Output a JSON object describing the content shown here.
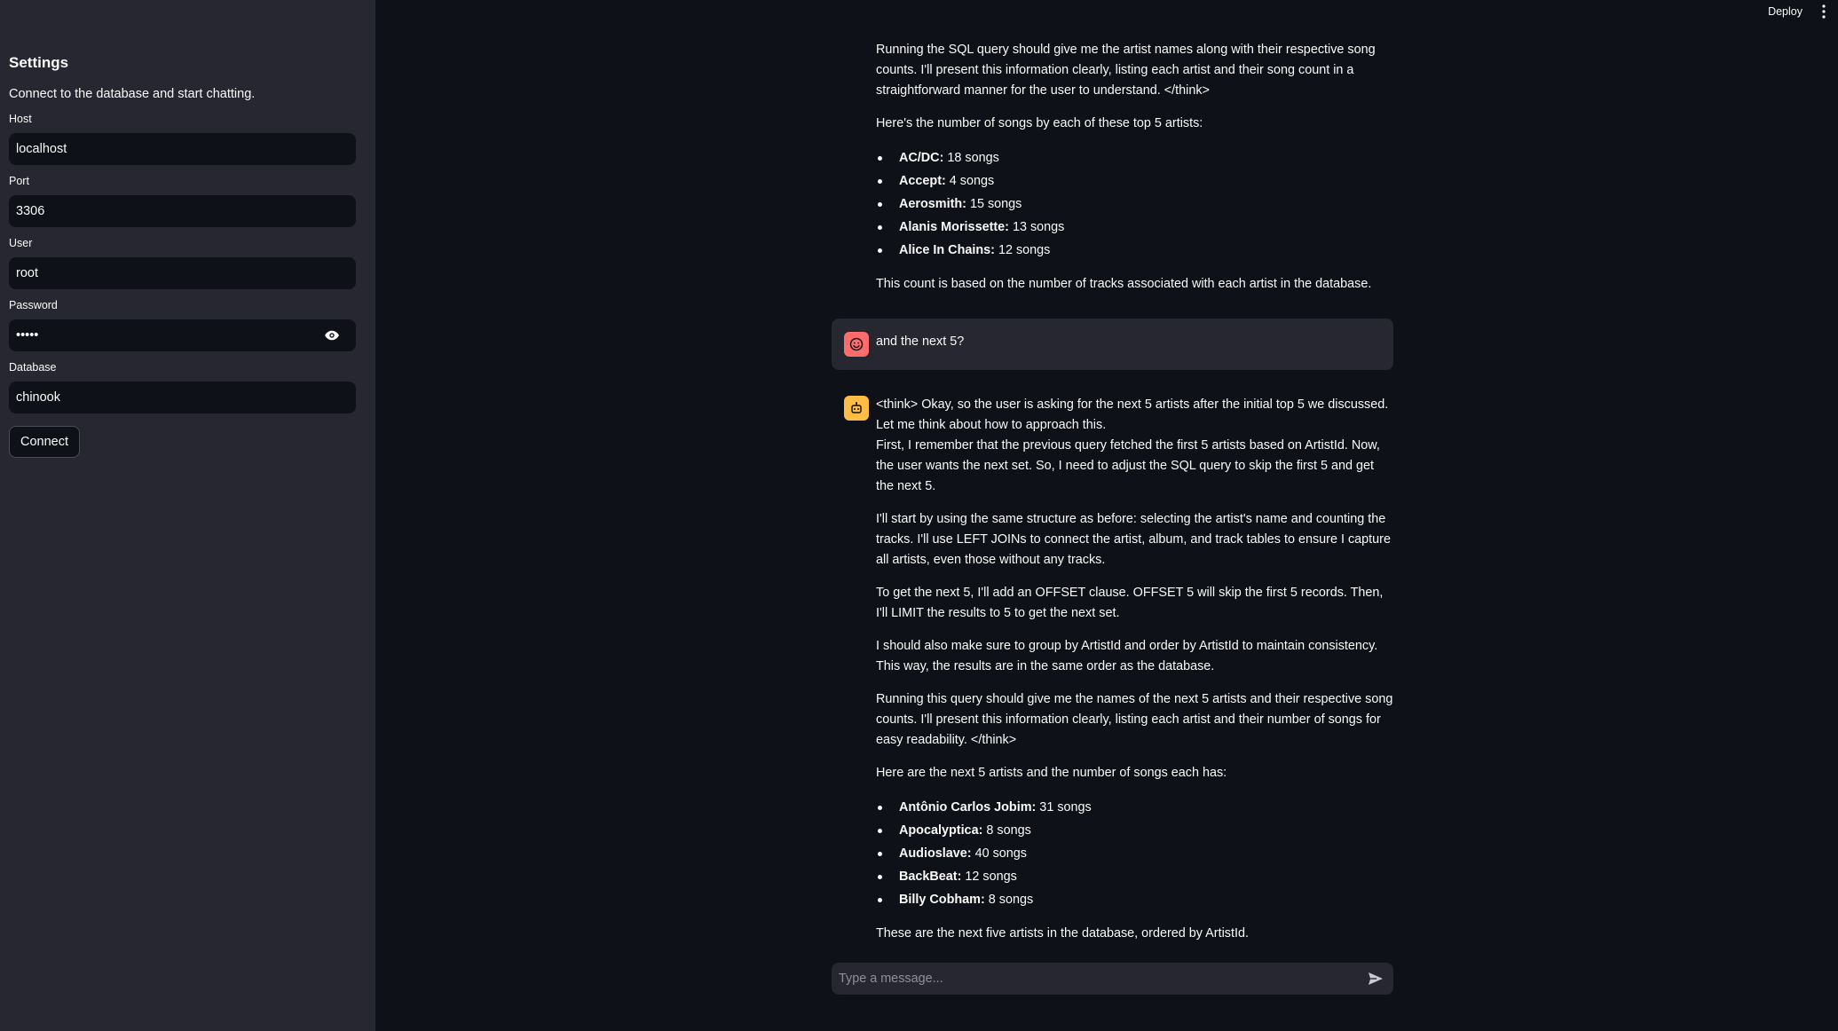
{
  "header": {
    "deploy_label": "Deploy",
    "menu_icon": "kebab-menu-icon"
  },
  "sidebar": {
    "title": "Settings",
    "caption": "Connect to the database and start chatting.",
    "fields": {
      "host": {
        "label": "Host",
        "value": "localhost"
      },
      "port": {
        "label": "Port",
        "value": "3306"
      },
      "user": {
        "label": "User",
        "value": "root"
      },
      "password": {
        "label": "Password",
        "value": "•••••"
      },
      "database": {
        "label": "Database",
        "value": "chinook"
      }
    },
    "connect_label": "Connect"
  },
  "chat": {
    "assistant_prev": {
      "p1": "Running the SQL query should give me the artist names along with their respective song counts. I'll present this information clearly, listing each artist and their song count in a straightforward manner for the user to understand. </think>",
      "p2": "Here's the number of songs by each of these top 5 artists:",
      "items": [
        {
          "name": "AC/DC:",
          "count": " 18 songs"
        },
        {
          "name": "Accept:",
          "count": " 4 songs"
        },
        {
          "name": "Aerosmith:",
          "count": " 15 songs"
        },
        {
          "name": "Alanis Morissette:",
          "count": " 13 songs"
        },
        {
          "name": "Alice In Chains:",
          "count": " 12 songs"
        }
      ],
      "p3": "This count is based on the number of tracks associated with each artist in the database."
    },
    "user_message": "and the next 5?",
    "assistant": {
      "p1a": "<think> Okay, so the user is asking for the next 5 artists after the initial top 5 we discussed. Let me think about how to approach this.",
      "p1b": "First, I remember that the previous query fetched the first 5 artists based on ArtistId. Now, the user wants the next set. So, I need to adjust the SQL query to skip the first 5 and get the next 5.",
      "p2": "I'll start by using the same structure as before: selecting the artist's name and counting the tracks. I'll use LEFT JOINs to connect the artist, album, and track tables to ensure I capture all artists, even those without any tracks.",
      "p3": "To get the next 5, I'll add an OFFSET clause. OFFSET 5 will skip the first 5 records. Then, I'll LIMIT the results to 5 to get the next set.",
      "p4": "I should also make sure to group by ArtistId and order by ArtistId to maintain consistency. This way, the results are in the same order as the database.",
      "p5": "Running this query should give me the names of the next 5 artists and their respective song counts. I'll present this information clearly, listing each artist and their number of songs for easy readability. </think>",
      "p6": "Here are the next 5 artists and the number of songs each has:",
      "items": [
        {
          "name": "Antônio Carlos Jobim:",
          "count": " 31 songs"
        },
        {
          "name": "Apocalyptica:",
          "count": " 8 songs"
        },
        {
          "name": "Audioslave:",
          "count": " 40 songs"
        },
        {
          "name": "BackBeat:",
          "count": " 12 songs"
        },
        {
          "name": "Billy Cobham:",
          "count": " 8 songs"
        }
      ],
      "p7": "These are the next five artists in the database, ordered by ArtistId."
    },
    "input_placeholder": "Type a message..."
  },
  "colors": {
    "main_bg": "#0e1117",
    "sidebar_bg": "#262730",
    "user_avatar": "#ff6c6c",
    "bot_avatar": "#ffbd45"
  }
}
